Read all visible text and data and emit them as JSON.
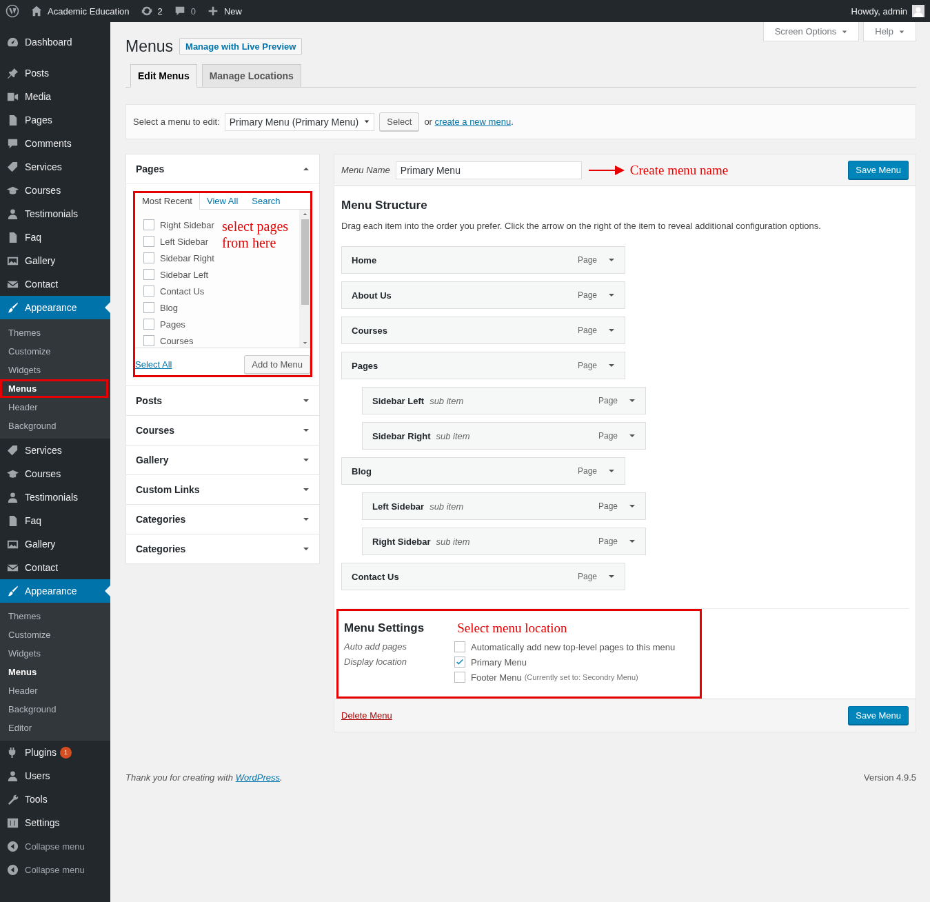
{
  "admin_bar": {
    "site_name": "Academic Education",
    "updates": "2",
    "comments": "0",
    "new_label": "New",
    "greeting": "Howdy, admin"
  },
  "sidebar": [
    {
      "kind": "menu",
      "label": "Dashboard",
      "current": false
    },
    {
      "kind": "menu",
      "label": "Posts",
      "current": false
    },
    {
      "kind": "menu",
      "label": "Media",
      "current": false
    },
    {
      "kind": "menu",
      "label": "Pages",
      "current": false
    },
    {
      "kind": "menu",
      "label": "Comments",
      "current": false
    },
    {
      "kind": "menu",
      "label": "Services",
      "current": false
    },
    {
      "kind": "menu",
      "label": "Courses",
      "current": false
    },
    {
      "kind": "menu",
      "label": "Testimonials",
      "current": false
    },
    {
      "kind": "menu",
      "label": "Faq",
      "current": false
    },
    {
      "kind": "menu",
      "label": "Gallery",
      "current": false
    },
    {
      "kind": "menu",
      "label": "Contact",
      "current": false
    },
    {
      "kind": "menu",
      "label": "Appearance",
      "current": true,
      "submenu": [
        {
          "label": "Themes",
          "selected": false,
          "annotated": false
        },
        {
          "label": "Customize",
          "selected": false,
          "annotated": false
        },
        {
          "label": "Widgets",
          "selected": false,
          "annotated": false
        },
        {
          "label": "Menus",
          "selected": true,
          "annotated": true
        },
        {
          "label": "Header",
          "selected": false,
          "annotated": false
        },
        {
          "label": "Background",
          "selected": false,
          "annotated": false
        }
      ]
    },
    {
      "kind": "menu",
      "label": "Services",
      "current": false
    },
    {
      "kind": "menu",
      "label": "Courses",
      "current": false
    },
    {
      "kind": "menu",
      "label": "Testimonials",
      "current": false
    },
    {
      "kind": "menu",
      "label": "Faq",
      "current": false
    },
    {
      "kind": "menu",
      "label": "Gallery",
      "current": false
    },
    {
      "kind": "menu",
      "label": "Contact",
      "current": false
    },
    {
      "kind": "menu",
      "label": "Appearance",
      "current": true,
      "submenu": [
        {
          "label": "Themes",
          "selected": false,
          "annotated": false
        },
        {
          "label": "Customize",
          "selected": false,
          "annotated": false
        },
        {
          "label": "Widgets",
          "selected": false,
          "annotated": false
        },
        {
          "label": "Menus",
          "selected": true,
          "annotated": false
        },
        {
          "label": "Header",
          "selected": false,
          "annotated": false
        },
        {
          "label": "Background",
          "selected": false,
          "annotated": false
        },
        {
          "label": "Editor",
          "selected": false,
          "annotated": false
        }
      ]
    },
    {
      "kind": "menu",
      "label": "Plugins",
      "current": false,
      "badge": "1"
    },
    {
      "kind": "menu",
      "label": "Users",
      "current": false
    },
    {
      "kind": "menu",
      "label": "Tools",
      "current": false
    },
    {
      "kind": "menu",
      "label": "Settings",
      "current": false
    },
    {
      "kind": "collapse",
      "label": "Collapse menu",
      "current": false
    },
    {
      "kind": "collapse",
      "label": "Collapse menu",
      "current": false
    }
  ],
  "screen_meta": [
    "Screen Options",
    "Help"
  ],
  "page": {
    "title": "Menus",
    "action": "Manage with Live Preview"
  },
  "tabs": [
    {
      "label": "Edit Menus",
      "selected": true
    },
    {
      "label": "Manage Locations",
      "selected": false
    }
  ],
  "menu_select": {
    "label": "Select a menu to edit:",
    "value": "Primary Menu (Primary Menu)",
    "button": "Select",
    "text_before": "or ",
    "link": "create a new menu",
    "text_after": "."
  },
  "accordion": [
    {
      "title": "Pages",
      "expanded": true
    },
    {
      "title": "Posts",
      "expanded": false
    },
    {
      "title": "Courses",
      "expanded": false
    },
    {
      "title": "Gallery",
      "expanded": false
    },
    {
      "title": "Custom Links",
      "expanded": false
    },
    {
      "title": "Categories",
      "expanded": false
    },
    {
      "title": "Categories",
      "expanded": false
    }
  ],
  "pages_panel": {
    "annotated": true,
    "tabs": [
      {
        "label": "Most Recent",
        "selected": true
      },
      {
        "label": "View All",
        "selected": false
      },
      {
        "label": "Search",
        "selected": false
      }
    ],
    "items": [
      {
        "label": "Right Sidebar",
        "checked": false
      },
      {
        "label": "Left Sidebar",
        "checked": false
      },
      {
        "label": "Sidebar Right",
        "checked": false
      },
      {
        "label": "Sidebar Left",
        "checked": false
      },
      {
        "label": "Contact Us",
        "checked": false
      },
      {
        "label": "Blog",
        "checked": false
      },
      {
        "label": "Pages",
        "checked": false
      },
      {
        "label": "Courses",
        "checked": false
      }
    ],
    "note": "select pages from here",
    "select_all": "Select All",
    "add_button": "Add to Menu"
  },
  "menu_editor": {
    "name_label": "Menu Name",
    "name_value": "Primary Menu",
    "name_note": "Create menu name",
    "save_button": "Save Menu",
    "structure_title": "Menu Structure",
    "structure_description": "Drag each item into the order you prefer. Click the arrow on the right of the item to reveal additional configuration options.",
    "items": [
      {
        "title": "Home",
        "type": "Page"
      },
      {
        "title": "About Us",
        "type": "Page"
      },
      {
        "title": "Courses",
        "type": "Page"
      },
      {
        "title": "Pages",
        "type": "Page",
        "children": [
          {
            "title": "Sidebar Left",
            "note": "sub item",
            "type": "Page"
          },
          {
            "title": "Sidebar Right",
            "note": "sub item",
            "type": "Page"
          }
        ]
      },
      {
        "title": "Blog",
        "type": "Page",
        "children": [
          {
            "title": "Left Sidebar",
            "note": "sub item",
            "type": "Page"
          },
          {
            "title": "Right Sidebar",
            "note": "sub item",
            "type": "Page"
          }
        ]
      },
      {
        "title": "Contact Us",
        "type": "Page"
      }
    ],
    "settings": {
      "annotated": true,
      "title": "Menu Settings",
      "note": "Select menu location",
      "rows": [
        {
          "label": "Auto add pages",
          "options": [
            {
              "label": "Automatically add new top-level pages to this menu",
              "checked": false
            }
          ]
        },
        {
          "label": "Display location",
          "options": [
            {
              "label": "Primary Menu",
              "checked": true
            },
            {
              "label": "Footer Menu",
              "detail": "(Currently set to: Secondry Menu)",
              "checked": false
            }
          ]
        }
      ]
    },
    "delete_link": "Delete Menu",
    "footer_save_button": "Save Menu"
  },
  "footer": {
    "text_before": "Thank you for creating with ",
    "link": "WordPress",
    "text_after": ".",
    "version": "Version 4.9.5"
  }
}
